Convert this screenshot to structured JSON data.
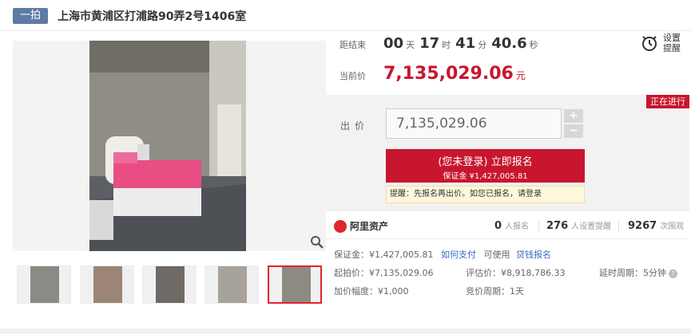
{
  "header": {
    "tag": "一拍",
    "title": "上海市黄浦区打浦路90弄2号1406室"
  },
  "timer": {
    "label": "距结束",
    "days": "00",
    "days_unit": "天",
    "hours": "17",
    "hours_unit": "时",
    "minutes": "41",
    "minutes_unit": "分",
    "seconds": "40.6",
    "seconds_unit": "秒"
  },
  "current_price": {
    "label": "当前价",
    "value": "7,135,029.06",
    "unit": "元"
  },
  "reminder": {
    "line1": "设置",
    "line2": "提醒"
  },
  "status_badge": "正在进行",
  "bid": {
    "label": "出价",
    "input_value": "7,135,029.06",
    "plus": "+",
    "minus": "−"
  },
  "signup": {
    "main": "(您未登录) 立即报名",
    "sub": "保证金 ¥1,427,005.81"
  },
  "tip": "提醒：先报名再出价。如您已报名，请登录",
  "stats": {
    "brand": "阿里资产",
    "signup_count": "0",
    "signup_unit": "人报名",
    "reminder_count": "276",
    "reminder_unit": "人设置提醒",
    "view_count": "9267",
    "view_unit": "次围观"
  },
  "details": {
    "deposit_label": "保证金：¥1,427,005.81",
    "pay_link": "如何支付",
    "usable": "可使用",
    "loan_link": "贷钱报名",
    "start_price": "起拍价：¥7,135,029.06",
    "estimate": "评估价：¥8,918,786.33",
    "delay": "延时周期：5分钟",
    "increment": "加价幅度：¥1,000",
    "bid_period": "竞价周期：1天"
  },
  "colors": {
    "accent_red": "#c8162e",
    "tag_blue": "#5f7aa6",
    "link_blue": "#3a6cc8"
  }
}
